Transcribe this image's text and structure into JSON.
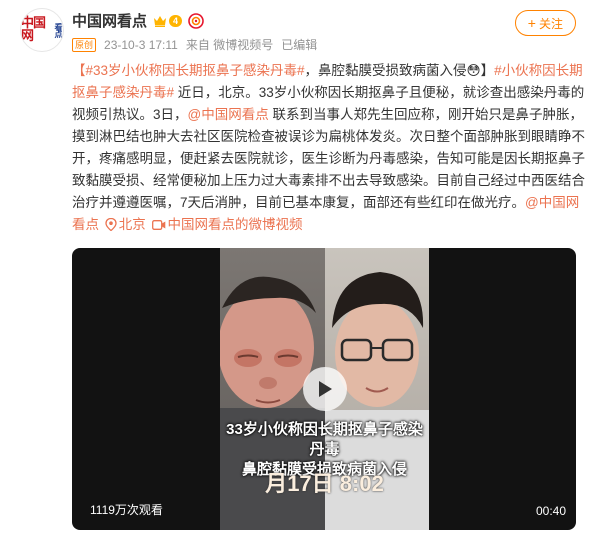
{
  "author": {
    "name": "中国网看点",
    "avatar_text": "中国网",
    "avatar_small": "看点",
    "vip_level": "4"
  },
  "meta": {
    "badge": "原创",
    "time": "23-10-3 17:11",
    "source": "来自 微博视频号",
    "edited": "已编辑"
  },
  "follow_label": "关注",
  "post": {
    "tag1": "【#33岁小伙称因长期抠鼻子感染丹毒#",
    "text1": "，鼻腔黏膜受损致病菌入侵",
    "emoji": "😳",
    "text1b": "】",
    "tag2": "#小伙称因长期抠鼻子感染丹毒#",
    "text2": " 近日，北京。33岁小伙称因长期抠鼻子且便秘，就诊查出感染丹毒的视频引热议。3日，",
    "mention1": "@中国网看点",
    "text3": " 联系到当事人郑先生回应称，刚开始只是鼻子肿胀，摸到淋巴结也肿大去社区医院检查被误诊为扁桃体发炎。次日整个面部肿胀到眼睛睁不开，疼痛感明显，便赶紧去医院就诊，医生诊断为丹毒感染，告知可能是因长期抠鼻子致黏膜受损、经常便秘加上压力过大毒素排不出去导致感染。目前自己经过中西医结合治疗并遵遵医嘱，7天后消肿，目前已基本康复，面部还有些红印在做光疗。",
    "mention2": "@中国网看点",
    "location": "北京",
    "video_link": "中国网看点的微博视频"
  },
  "video": {
    "caption_line1": "33岁小伙称因长期抠鼻子感染丹毒",
    "caption_line2": "鼻腔黏膜受损致病菌入侵",
    "date_overlay": "月17日 8:02",
    "views": "1119万次观看",
    "duration": "00:40"
  },
  "colors": {
    "accent": "#ff8200",
    "link": "#eb7350",
    "text": "#333333",
    "meta": "#939393",
    "video_bg": "#121212"
  },
  "icons": {
    "vip": "crown-icon",
    "live": "live-ring-icon",
    "link": "link-icon",
    "location": "location-pin-icon",
    "video": "video-camera-icon",
    "play": "play-icon"
  }
}
